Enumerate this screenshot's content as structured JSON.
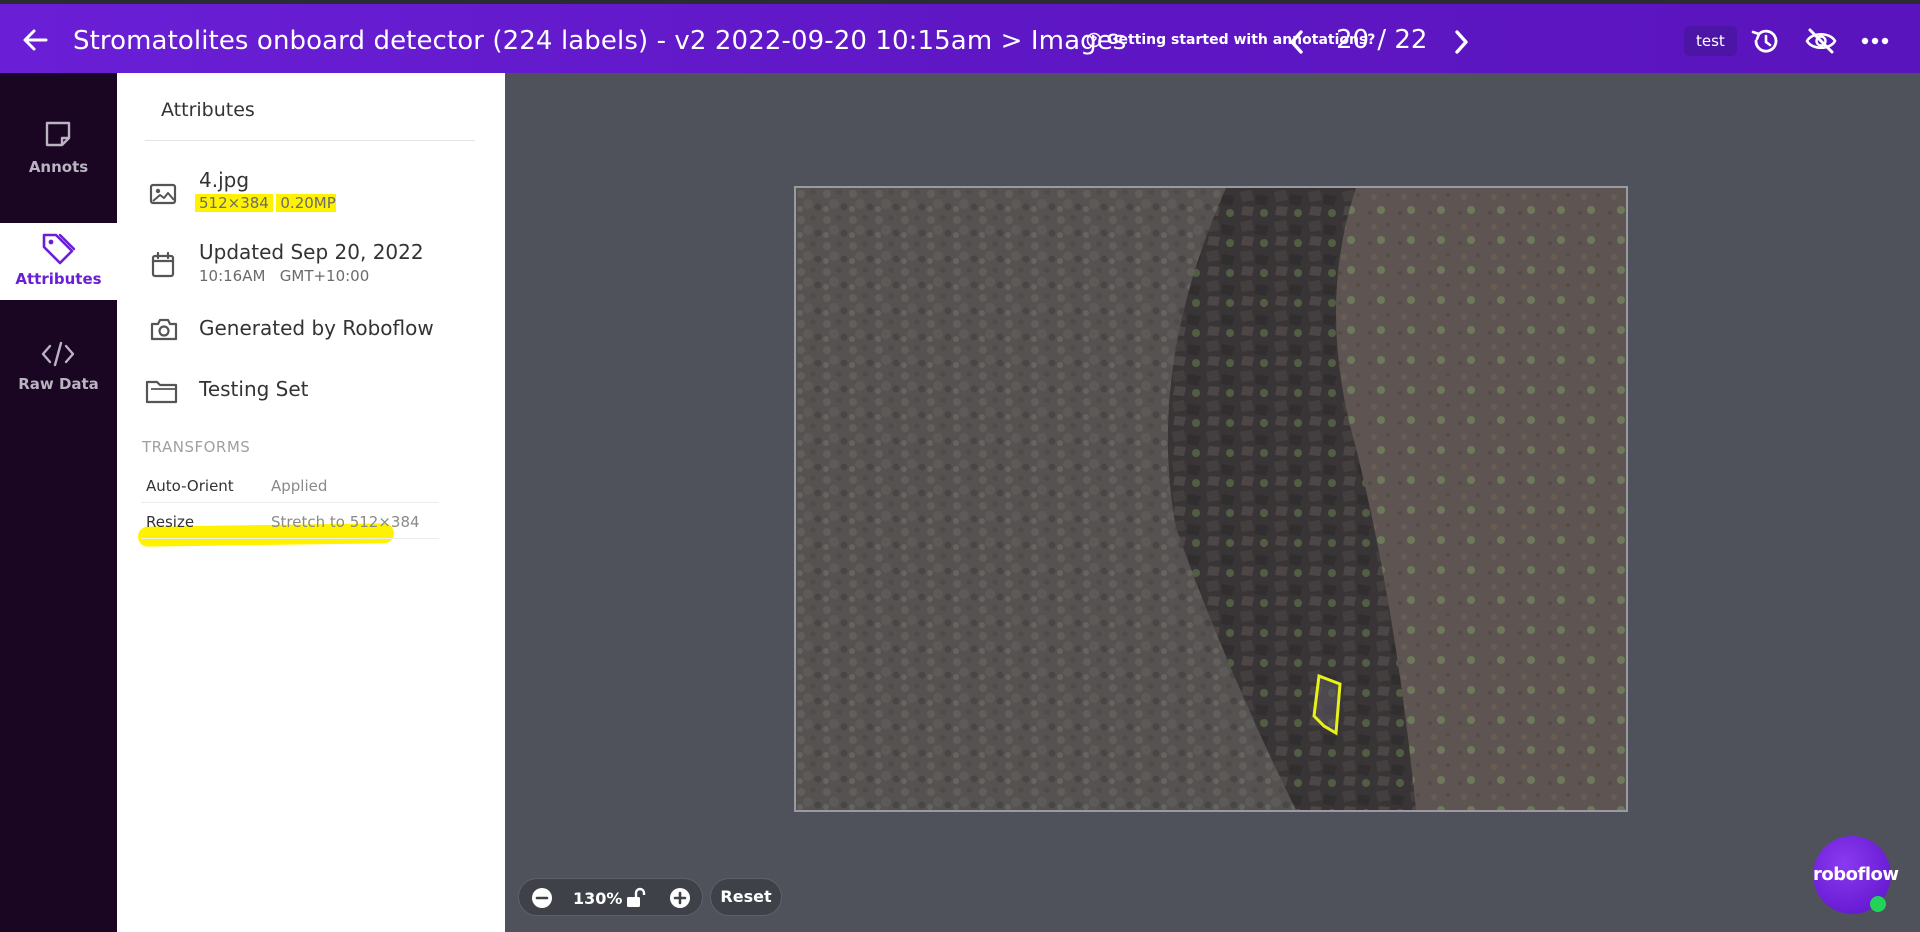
{
  "topbar": {
    "title": "Stromatolites onboard detector (224 labels) - v2 2022-09-20 10:15am > Images",
    "help_text": "Getting started with annotations?",
    "pager": "20 / 22",
    "badge": "test"
  },
  "nav": {
    "items": [
      {
        "label": "Annots",
        "icon": "note-icon"
      },
      {
        "label": "Attributes",
        "icon": "tag-icon"
      },
      {
        "label": "Raw Data",
        "icon": "code-icon"
      }
    ]
  },
  "attributes": {
    "title": "Attributes",
    "file": {
      "name": "4.jpg",
      "dims": "512×384",
      "mp": "0.20MP"
    },
    "updated": {
      "date": "Updated Sep 20, 2022",
      "time": "10:16AM",
      "tz": "GMT+10:00"
    },
    "generated": "Generated by Roboflow",
    "split": "Testing Set",
    "transforms_label": "TRANSFORMS",
    "transforms": [
      {
        "key": "Auto-Orient",
        "value": "Applied"
      },
      {
        "key": "Resize",
        "value": "Stretch to 512×384"
      }
    ]
  },
  "zoom": {
    "level": "130%",
    "reset": "Reset"
  },
  "brand": {
    "bubble": "roboflow",
    "accent": "#6a1fd6",
    "highlight": "#fff200"
  }
}
